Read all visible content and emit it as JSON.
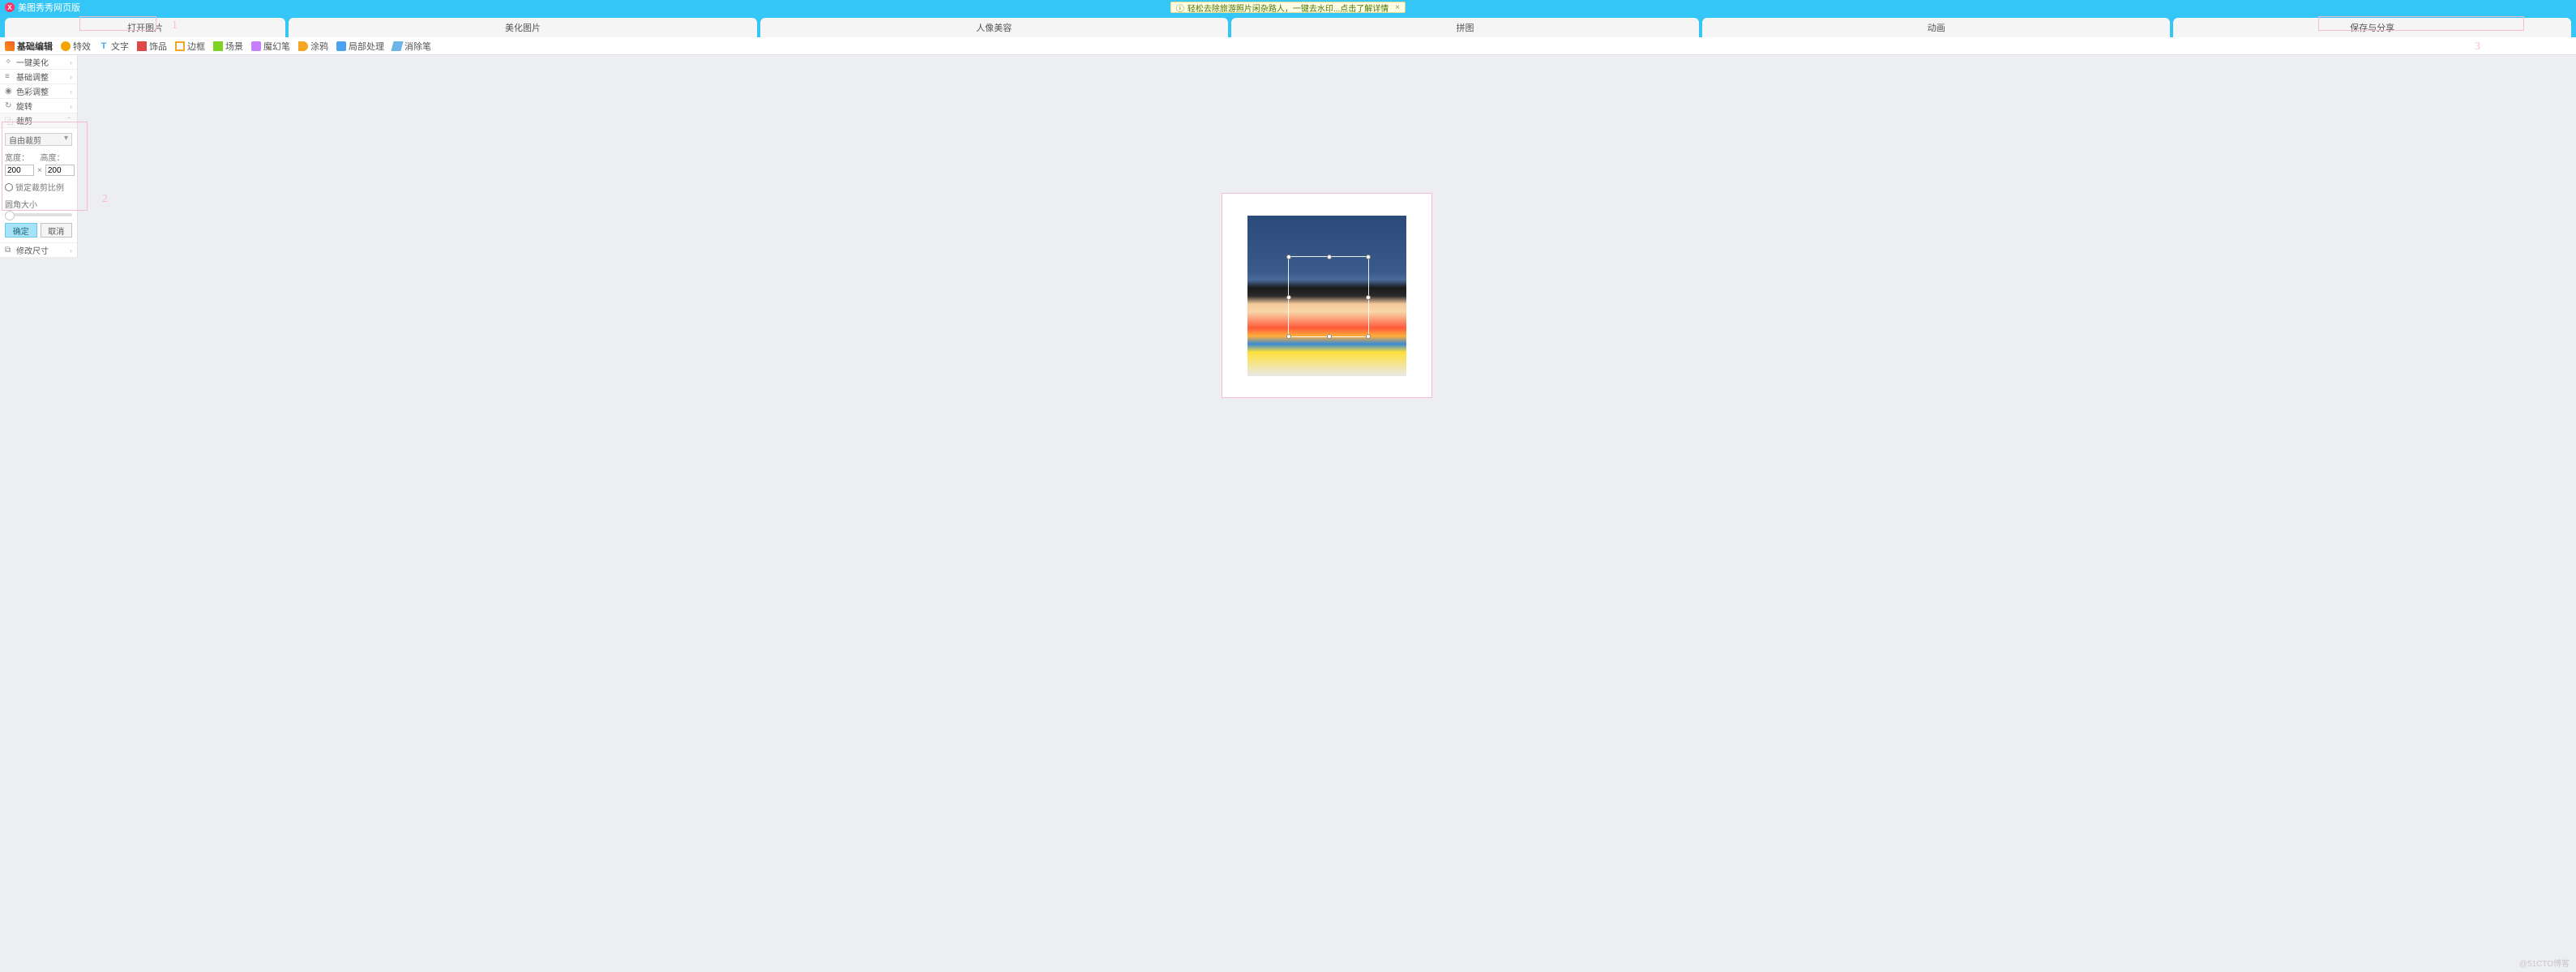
{
  "title_bar": {
    "app_name": "美图秀秀网页版"
  },
  "promo": {
    "text": "轻松去除旅游照片闲杂路人，一键去水印...点击了解详情"
  },
  "main_tabs": [
    "打开图片",
    "美化图片",
    "人像美容",
    "拼图",
    "动画",
    "保存与分享"
  ],
  "tool_bar": [
    {
      "label": "基础编辑"
    },
    {
      "label": "特效"
    },
    {
      "label": "文字"
    },
    {
      "label": "饰品"
    },
    {
      "label": "边框"
    },
    {
      "label": "场景"
    },
    {
      "label": "魔幻笔"
    },
    {
      "label": "涂鸦"
    },
    {
      "label": "局部处理"
    },
    {
      "label": "消除笔"
    }
  ],
  "accordion": {
    "items": [
      "一键美化",
      "基础调整",
      "色彩调整",
      "旋转",
      "裁剪",
      "修改尺寸"
    ],
    "icons": [
      "✧",
      "≡",
      "◉",
      "↻",
      "⿻",
      "⧉"
    ]
  },
  "crop_panel": {
    "mode": "自由裁剪",
    "width_label": "宽度：",
    "height_label": "高度：",
    "width_value": "200",
    "height_value": "200",
    "lock_label": "锁定裁剪比例",
    "slider_label": "圆角大小",
    "ok": "确定",
    "cancel": "取消"
  },
  "annotations": {
    "a1": "1",
    "a2": "2",
    "a3": "3"
  },
  "watermark": "@51CTO博客"
}
